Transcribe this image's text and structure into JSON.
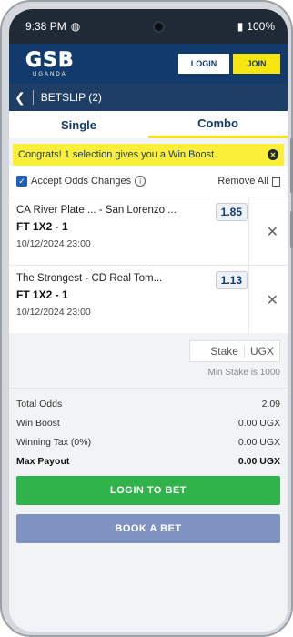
{
  "status": {
    "time": "9:38 PM",
    "battery": "100%"
  },
  "header": {
    "logo": "GSB",
    "logo_sub": "UGANDA",
    "login_label": "LOGIN",
    "join_label": "JOIN"
  },
  "betslip": {
    "title": "BETSLIP (2)"
  },
  "tabs": [
    {
      "label": "Single"
    },
    {
      "label": "Combo"
    }
  ],
  "boost_message": "Congrats! 1 selection gives you a Win Boost.",
  "controls": {
    "accept_label": "Accept Odds Changes",
    "remove_all_label": "Remove All"
  },
  "selections": [
    {
      "teams": "CA River Plate ... - San Lorenzo ...",
      "market": "FT 1X2 - 1",
      "date": "10/12/2024 23:00",
      "odds": "1.85"
    },
    {
      "teams": "The Strongest - CD Real Tom...",
      "market": "FT 1X2 - 1",
      "date": "10/12/2024 23:00",
      "odds": "1.13"
    }
  ],
  "stake": {
    "placeholder": "Stake",
    "currency": "UGX",
    "min_text": "Min Stake is 1000"
  },
  "summary": [
    {
      "label": "Total Odds",
      "value": "2.09"
    },
    {
      "label": "Win Boost",
      "value": "0.00 UGX"
    },
    {
      "label": "Winning Tax (0%)",
      "value": "0.00 UGX"
    },
    {
      "label": "Max Payout",
      "value": "0.00 UGX"
    }
  ],
  "actions": {
    "login_to_bet": "LOGIN TO BET",
    "book_a_bet": "BOOK A BET"
  },
  "colors": {
    "brand": "#123a6b",
    "accent": "#f7e50f",
    "login": "#2fb34a",
    "book": "#7f93c2"
  }
}
